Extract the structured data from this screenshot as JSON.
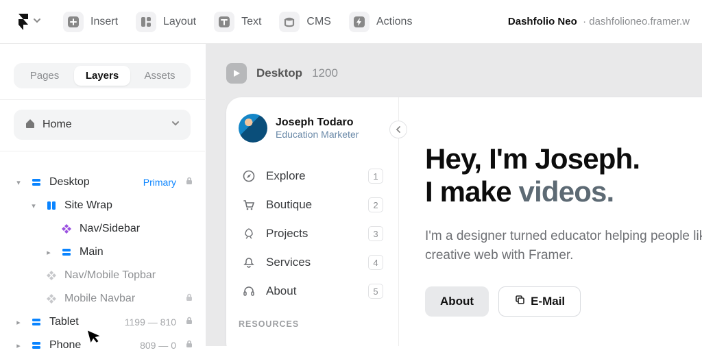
{
  "toolbar": {
    "insert": "Insert",
    "layout": "Layout",
    "text": "Text",
    "cms": "CMS",
    "actions": "Actions",
    "project_name": "Dashfolio Neo",
    "project_url": "dashfolioneo.framer.w"
  },
  "panel": {
    "tab_pages": "Pages",
    "tab_layers": "Layers",
    "tab_assets": "Assets",
    "home_label": "Home"
  },
  "tree": {
    "desktop": "Desktop",
    "desktop_badge": "Primary",
    "site_wrap": "Site Wrap",
    "nav_sidebar": "Nav/Sidebar",
    "main": "Main",
    "nav_mobile": "Nav/Mobile Topbar",
    "mobile_navbar": "Mobile Navbar",
    "tablet": "Tablet",
    "tablet_range": "1199 — 810",
    "phone": "Phone",
    "phone_range": "809 — 0"
  },
  "canvas": {
    "device_label": "Desktop",
    "device_width": "1200"
  },
  "site": {
    "profile_name": "Joseph Todaro",
    "profile_role": "Education Marketer",
    "nav": [
      {
        "label": "Explore",
        "key": "1"
      },
      {
        "label": "Boutique",
        "key": "2"
      },
      {
        "label": "Projects",
        "key": "3"
      },
      {
        "label": "Services",
        "key": "4"
      },
      {
        "label": "About",
        "key": "5"
      }
    ],
    "resources_heading": "RESOURCES",
    "hero_line1_a": "Hey, I'm Joseph.",
    "hero_line2_a": "I make ",
    "hero_line2_b": "videos.",
    "hero_sub": "I'm a designer turned educator helping people like y creative web with Framer.",
    "btn_about": "About",
    "btn_email": "E-Mail"
  }
}
